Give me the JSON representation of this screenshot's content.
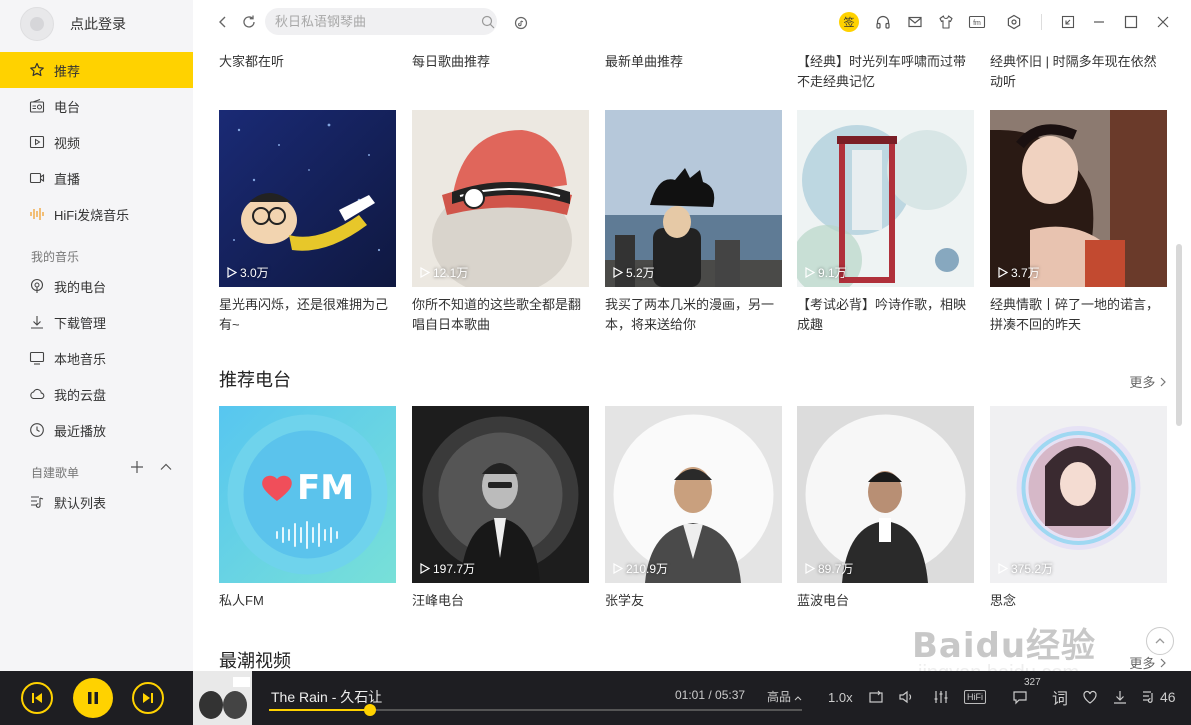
{
  "sidebar": {
    "login_text": "点此登录",
    "nav": [
      {
        "label": "推荐",
        "icon": "star-icon"
      },
      {
        "label": "电台",
        "icon": "radio-icon"
      },
      {
        "label": "视频",
        "icon": "video-icon"
      },
      {
        "label": "直播",
        "icon": "live-camera-icon"
      },
      {
        "label": "HiFi发烧音乐",
        "icon": "hifi-wave-icon"
      }
    ],
    "my_music_label": "我的音乐",
    "my_music": [
      {
        "label": "我的电台",
        "icon": "radio-signal-icon"
      },
      {
        "label": "下载管理",
        "icon": "download-icon"
      },
      {
        "label": "本地音乐",
        "icon": "monitor-icon"
      },
      {
        "label": "我的云盘",
        "icon": "cloud-icon"
      },
      {
        "label": "最近播放",
        "icon": "clock-icon"
      }
    ],
    "playlist_label": "自建歌单",
    "playlists": [
      {
        "label": "默认列表",
        "icon": "playlist-icon"
      }
    ]
  },
  "topbar": {
    "search_placeholder": "秋日私语钢琴曲",
    "sign_label": "签"
  },
  "recommend": {
    "titles": [
      "大家都在听",
      "每日歌曲推荐",
      "最新单曲推荐",
      "【经典】时光列车呼啸而过带不走经典记忆",
      "经典怀旧 | 时隔多年现在依然动听"
    ],
    "cards": [
      {
        "count": "3.0万",
        "caption": "星光再闪烁，还是很难拥为己有~",
        "bg": "#1f2c6b"
      },
      {
        "count": "12.1万",
        "caption": "你所不知道的这些歌全都是翻唱自日本歌曲",
        "bg": "#e9e4dc"
      },
      {
        "count": "5.2万",
        "caption": "我买了两本几米的漫画，另一本，将来送给你",
        "bg": "#9fb3c8"
      },
      {
        "count": "9.1万",
        "caption": "【考试必背】吟诗作歌，相映成趣",
        "bg": "#dfe9ec"
      },
      {
        "count": "3.7万",
        "caption": "经典情歌丨碎了一地的诺言，拼凑不回的昨天",
        "bg": "#b9a79c"
      }
    ]
  },
  "radio": {
    "title": "推荐电台",
    "more": "更多",
    "cards": [
      {
        "count": "",
        "caption": "私人FM",
        "fm_label": "FM"
      },
      {
        "count": "197.7万",
        "caption": "汪峰电台"
      },
      {
        "count": "210.9万",
        "caption": "张学友"
      },
      {
        "count": "89.7万",
        "caption": "蓝波电台"
      },
      {
        "count": "375.2万",
        "caption": "思念"
      }
    ]
  },
  "videos": {
    "title": "最潮视频",
    "more": "更多"
  },
  "watermark": {
    "text": "Baidu经验",
    "url": "jingyan.baidu.com"
  },
  "player": {
    "song": "The Rain - 久石让",
    "current_time": "01:01",
    "total_time": "05:37",
    "quality": "高品",
    "speed": "1.0x",
    "hifi": "HiFi",
    "comment_count": "327",
    "lyrics": "词",
    "playlist_count": "46",
    "progress": 0.19,
    "accent": "#ffd200"
  }
}
